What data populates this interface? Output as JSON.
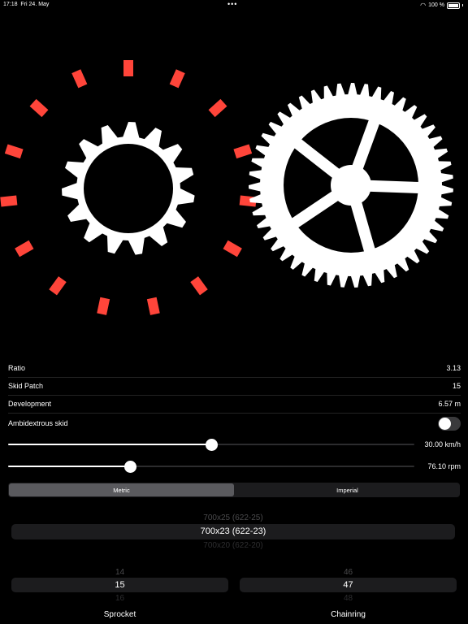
{
  "status_bar": {
    "time": "17:18",
    "date": "Fri 24. May",
    "battery": "100 %"
  },
  "stats": [
    {
      "label": "Ratio",
      "value": "3.13"
    },
    {
      "label": "Skid Patch",
      "value": "15"
    },
    {
      "label": "Development",
      "value": "6.57 m"
    }
  ],
  "toggle": {
    "label": "Ambidextrous skid",
    "on": false
  },
  "speed_slider": {
    "value_label": "30.00 km/h",
    "level": 0.5
  },
  "cadence_slider": {
    "value_label": "76.10 rpm",
    "level": 0.3
  },
  "units": {
    "metric": "Metric",
    "imperial": "Imperial",
    "selected": "Metric"
  },
  "tire_picker": {
    "above": "700x25 (622-25)",
    "selected": "700x23 (622-23)",
    "below": "700x20 (622-20)"
  },
  "sprocket_picker": {
    "above": "14",
    "selected": "15",
    "below": "16",
    "caption": "Sprocket"
  },
  "chainring_picker": {
    "above": "46",
    "selected": "47",
    "below": "48",
    "caption": "Chainring"
  },
  "colors": {
    "skid_marks": "#ff453a",
    "gear": "#ffffff",
    "background": "#000000"
  }
}
